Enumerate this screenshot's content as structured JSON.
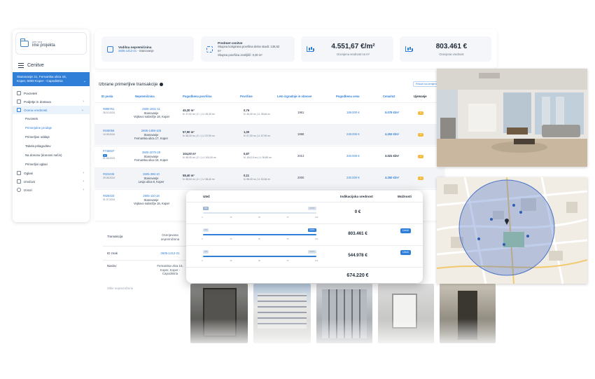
{
  "sidebar": {
    "project_small": "ime seq",
    "project_name": "ime projekta",
    "section_title": "Cenitve",
    "address": [
      "Stanovanje 31, Fernarska ulica 16,",
      "Koper, 6000 Koper - Capodistria"
    ],
    "items": [
      {
        "label": "Povzetek",
        "icon": "clipboard-icon"
      },
      {
        "label": "Podjetje in dostava",
        "icon": "package-icon"
      },
      {
        "label": "Ocena vrednosti",
        "icon": "chart-icon"
      }
    ],
    "subitems": [
      "Povzetek",
      "Primerjalne prodaje",
      "Primerljive oddaje",
      "Tabela prilagoditev",
      "Na donosu (donosni način)",
      "Primerljivi oglasi"
    ],
    "bottom_items": [
      {
        "label": "Oglasi",
        "icon": "megaphone-icon"
      },
      {
        "label": "Izračuni",
        "icon": "calculator-icon"
      },
      {
        "label": "Izvozi",
        "icon": "cloud-icon"
      }
    ]
  },
  "cards": {
    "card1_title": "Vodilna nepremičnina",
    "card1_link": "2605-1412-21",
    "card1_sub": " - Stanovanje",
    "card2_title": "Predmet cenitve",
    "card2_line1": "Skupna korigirana površina delov stavb: 136,52",
    "card2_line2": "m²",
    "card2_line3": "Skupna površina zemljišč: 0,00 m²",
    "card3_value": "4.551,67 €/m²",
    "card3_label": "Ocenjena vrednost na m²",
    "card4_value": "803.461 €",
    "card4_label": "Ocenjena vrednost"
  },
  "table": {
    "title": "Izbrane primerljive transakcije",
    "map_button": "Prikaži na zemljevidu",
    "headers": [
      "ID posla",
      "Nepremičnina",
      "Pogodbena površina",
      "Površine",
      "Leto izgradnje in obnove",
      "Pogodbena cena",
      "Cena/m2",
      "Ujemanje"
    ],
    "rows": [
      {
        "id": "#885761",
        "date": "28.10.2024",
        "prop_id": "2605-1501-11",
        "type": "Stanovanje",
        "addr": "Vojkovo nabrežje 18, Koper",
        "area": "45,30 m²",
        "area_sub": "N: 37,02 m² | Z: / | U: 45,30 m²",
        "surf": "0,76",
        "surf_sub": "N: 45,30 m² | U: 38,46 m²",
        "year": "1961",
        "price": "189.000 €",
        "ppm": "5.078 €/m²",
        "match": "4"
      },
      {
        "id": "#849056",
        "date": "10.09.2024",
        "prop_id": "2605-1498-105",
        "type": "Stanovanje",
        "addr": "Fernarska ulica 17, Koper",
        "area": "57,90 m²",
        "area_sub": "N: 58,33 m² | Z: / | U: 57,90 m²",
        "surf": "1,00",
        "surf_sub": "N: 57,90 m² | U: 57,90 m²",
        "year": "1998",
        "price": "249.000 €",
        "ppm": "4.253 €/m²",
        "match": "4"
      },
      {
        "id": "#746837",
        "date": "01.06.2023",
        "tag": "2",
        "prop_id": "2605-2070-29",
        "type": "Stanovanje",
        "addr": "Fernarska ulica 16, Koper",
        "area": "104,00 m²",
        "area_sub": "N: 96,90 m² | Z: / | U: 104,00 m²",
        "surf": "0,87",
        "surf_sub": "N: 104,10 m² | U: 90,80 m²",
        "year": "2013",
        "price": "340.000 €",
        "ppm": "3.021 €/m²",
        "match": "4"
      },
      {
        "id": "#823236",
        "date": "29.08.2024",
        "prop_id": "2605-396-10",
        "type": "Stanovanje",
        "addr": "Levja ulica 8, Koper",
        "area": "58,40 m²",
        "area_sub": "N: 58,54 m² | Z: / | U: 58,40 m²",
        "surf": "0,11",
        "surf_sub": "N: 58,40 m² | U: 53,36 m²",
        "year": "2000",
        "price": "230.000 €",
        "ppm": "4.250 €/m²",
        "match": "4"
      },
      {
        "id": "#828433",
        "date": "01.07.2024",
        "prop_id": "2605-110-18",
        "type": "Stanovanje",
        "addr": "Vojkovo nabrežje 16, Koper",
        "area": "",
        "area_sub": "",
        "surf": "",
        "surf_sub": "",
        "year": "",
        "price": "",
        "ppm": "",
        "match": ""
      }
    ]
  },
  "lower": {
    "label1": "Transakcija",
    "value1": "Ocenjevana nepremičnina",
    "label2": "ID znak",
    "value2": "2605-1412-21",
    "label3": "Naslov",
    "value3": "Fernarska ulica 15, Koper, Koper - Capodistria",
    "label4": "Slike nepremičnine"
  },
  "valuation": {
    "col1": "Utež",
    "col2": "Indikacijska vrednost",
    "col3": "Možnosti",
    "rows": [
      {
        "pct_label": "0%",
        "end_label": "100%",
        "fill": 0.0,
        "value": "0 €",
        "button": ""
      },
      {
        "pct_label": "0%",
        "end_label": "100%",
        "fill": 1.0,
        "value": "803.461 €",
        "button": "Uredi"
      },
      {
        "pct_label": "0%",
        "end_label": "100%",
        "fill": 1.0,
        "value": "544.978 €",
        "button": "Uredi"
      }
    ],
    "ticks": [
      "0",
      "25",
      "50",
      "75",
      "100"
    ],
    "total": "674.220 €"
  },
  "colors": {
    "accent": "#2f7ed8",
    "badge": "#f6b93b",
    "map_circle": "#4a72c8"
  }
}
